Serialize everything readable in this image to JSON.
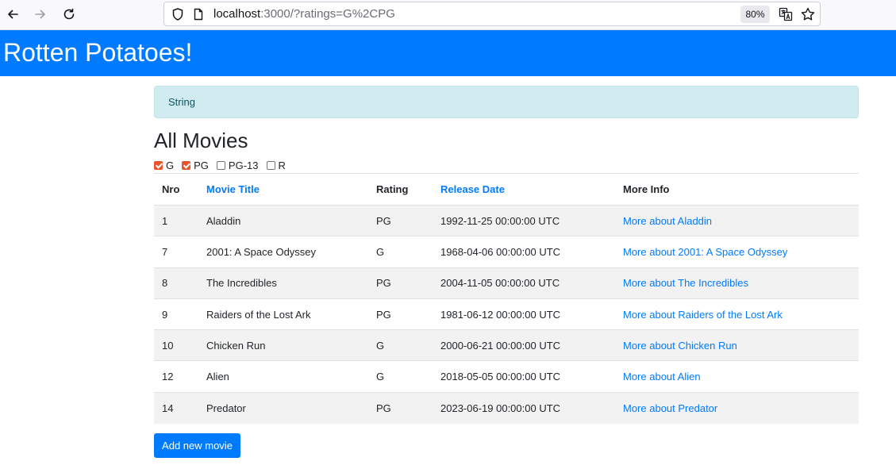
{
  "browser": {
    "url_host": "localhost",
    "url_rest": ":3000/?ratings=G%2CPG",
    "zoom": "80%"
  },
  "header": {
    "title": "Rotten Potatoes!"
  },
  "alert": {
    "text": "String"
  },
  "page": {
    "heading": "All Movies"
  },
  "filters": [
    {
      "label": "G",
      "checked": true
    },
    {
      "label": "PG",
      "checked": true
    },
    {
      "label": "PG-13",
      "checked": false
    },
    {
      "label": "R",
      "checked": false
    }
  ],
  "table": {
    "headers": {
      "nro": "Nro",
      "title": "Movie Title",
      "rating": "Rating",
      "release": "Release Date",
      "info": "More Info"
    },
    "rows": [
      {
        "nro": "1",
        "title": "Aladdin",
        "rating": "PG",
        "release": "1992-11-25 00:00:00 UTC",
        "link": "More about Aladdin"
      },
      {
        "nro": "7",
        "title": "2001: A Space Odyssey",
        "rating": "G",
        "release": "1968-04-06 00:00:00 UTC",
        "link": "More about 2001: A Space Odyssey"
      },
      {
        "nro": "8",
        "title": "The Incredibles",
        "rating": "PG",
        "release": "2004-11-05 00:00:00 UTC",
        "link": "More about The Incredibles"
      },
      {
        "nro": "9",
        "title": "Raiders of the Lost Ark",
        "rating": "PG",
        "release": "1981-06-12 00:00:00 UTC",
        "link": "More about Raiders of the Lost Ark"
      },
      {
        "nro": "10",
        "title": "Chicken Run",
        "rating": "G",
        "release": "2000-06-21 00:00:00 UTC",
        "link": "More about Chicken Run"
      },
      {
        "nro": "12",
        "title": "Alien",
        "rating": "G",
        "release": "2018-05-05 00:00:00 UTC",
        "link": "More about Alien"
      },
      {
        "nro": "14",
        "title": "Predator",
        "rating": "PG",
        "release": "2023-06-19 00:00:00 UTC",
        "link": "More about Predator"
      }
    ]
  },
  "actions": {
    "add_label": "Add new movie"
  },
  "colors": {
    "primary": "#007bff",
    "alert_bg": "#d1ecf1",
    "alert_text": "#0c5460",
    "checkbox_checked": "#e5542b"
  }
}
